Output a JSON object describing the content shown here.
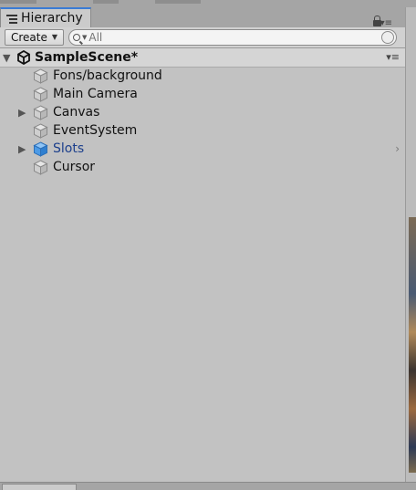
{
  "window": {
    "tab_label": "Hierarchy",
    "tab_icon": "hierarchy-list-icon"
  },
  "toolbar": {
    "create_label": "Create",
    "search_placeholder": "All"
  },
  "scene": {
    "name": "SampleScene*",
    "icon": "unity-logo-icon"
  },
  "hierarchy": {
    "items": [
      {
        "label": "Fons/background",
        "expandable": false,
        "icon": "gameobject-cube-icon"
      },
      {
        "label": "Main Camera",
        "expandable": false,
        "icon": "gameobject-cube-icon"
      },
      {
        "label": "Canvas",
        "expandable": true,
        "icon": "gameobject-cube-icon"
      },
      {
        "label": "EventSystem",
        "expandable": false,
        "icon": "gameobject-cube-icon"
      },
      {
        "label": "Slots",
        "expandable": true,
        "icon": "prefab-cube-icon",
        "color": "#1c3f8c"
      },
      {
        "label": "Cursor",
        "expandable": false,
        "icon": "gameobject-cube-icon"
      }
    ]
  },
  "colors": {
    "panel_bg": "#c2c2c2",
    "tab_accent": "#3a7bd5",
    "prefab_text": "#1c3f8c",
    "prefab_icon": "#3b8fe0"
  }
}
